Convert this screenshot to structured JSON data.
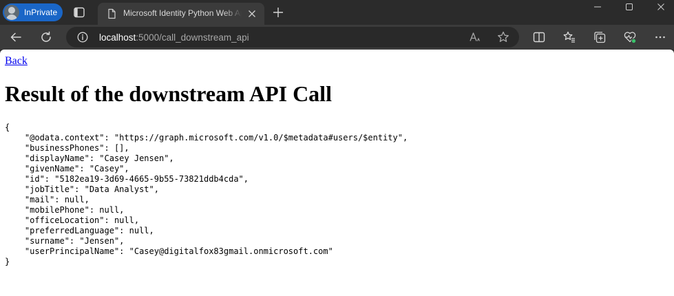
{
  "browser": {
    "inprivate_label": "InPrivate",
    "tab": {
      "title": "Microsoft Identity Python Web App"
    },
    "address": {
      "host": "localhost",
      "path": ":5000/call_downstream_api"
    }
  },
  "page": {
    "back_link": "Back",
    "title": "Result of the downstream API Call",
    "json_lines": [
      "{",
      "    \"@odata.context\": \"https://graph.microsoft.com/v1.0/$metadata#users/$entity\",",
      "    \"businessPhones\": [],",
      "    \"displayName\": \"Casey Jensen\",",
      "    \"givenName\": \"Casey\",",
      "    \"id\": \"5182ea19-3d69-4665-9b55-73821ddb4cda\",",
      "    \"jobTitle\": \"Data Analyst\",",
      "    \"mail\": null,",
      "    \"mobilePhone\": null,",
      "    \"officeLocation\": null,",
      "    \"preferredLanguage\": null,",
      "    \"surname\": \"Jensen\",",
      "    \"userPrincipalName\": \"Casey@digitalfox83gmail.onmicrosoft.com\"",
      "}"
    ]
  },
  "icons": {
    "profile": "avatar-icon",
    "tab_actions": "tab-actions-icon",
    "tab_page": "document-icon",
    "tab_close": "close-icon",
    "new_tab": "plus-icon",
    "back": "arrow-left-icon",
    "refresh": "refresh-icon",
    "site_info": "info-icon",
    "read_aloud": "read-aloud-icon",
    "favorite": "star-icon",
    "split_screen": "split-screen-icon",
    "favorites": "favorites-icon",
    "collections": "collections-icon",
    "browser_essentials": "heart-pulse-icon",
    "more": "ellipsis-icon"
  },
  "colors": {
    "chrome_bg": "#2b2b2b",
    "toolbar_bg": "#3b3b3b",
    "inprivate_accent": "#1a66c7",
    "link": "#0000ee",
    "status_ok": "#3ac16a"
  }
}
